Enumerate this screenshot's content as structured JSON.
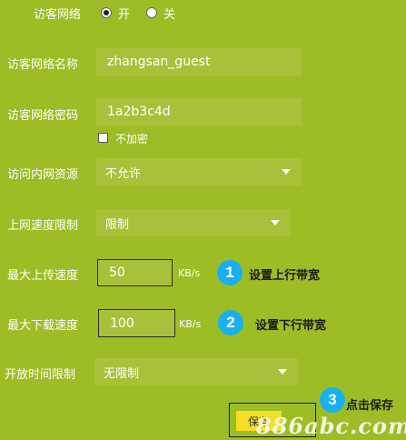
{
  "guest_network": {
    "label": "访客网络",
    "on_label": "开",
    "off_label": "关",
    "selected": "on"
  },
  "network_name": {
    "label": "访客网络名称",
    "value": "zhangsan_guest"
  },
  "network_password": {
    "label": "访客网络密码",
    "value": "1a2b3c4d",
    "no_encrypt_label": "不加密",
    "no_encrypt_checked": false
  },
  "intranet_access": {
    "label": "访问内网资源",
    "value": "不允许"
  },
  "speed_limit": {
    "label": "上网速度限制",
    "value": "限制"
  },
  "max_upload": {
    "label": "最大上传速度",
    "value": "50",
    "unit": "KB/s"
  },
  "max_download": {
    "label": "最大下载速度",
    "value": "100",
    "unit": "KB/s"
  },
  "open_time": {
    "label": "开放时间限制",
    "value": "无限制"
  },
  "save": {
    "label": "保存"
  },
  "annotations": [
    {
      "number": "1",
      "text": "设置上行带宽"
    },
    {
      "number": "2",
      "text": "设置下行带宽"
    },
    {
      "number": "3",
      "text": "点击保存"
    }
  ],
  "watermark": "886abc.com",
  "colors": {
    "background": "#9dbd26",
    "field": "#a7c23a",
    "badge": "#1ab0f0",
    "save_button": "#f4df24"
  }
}
